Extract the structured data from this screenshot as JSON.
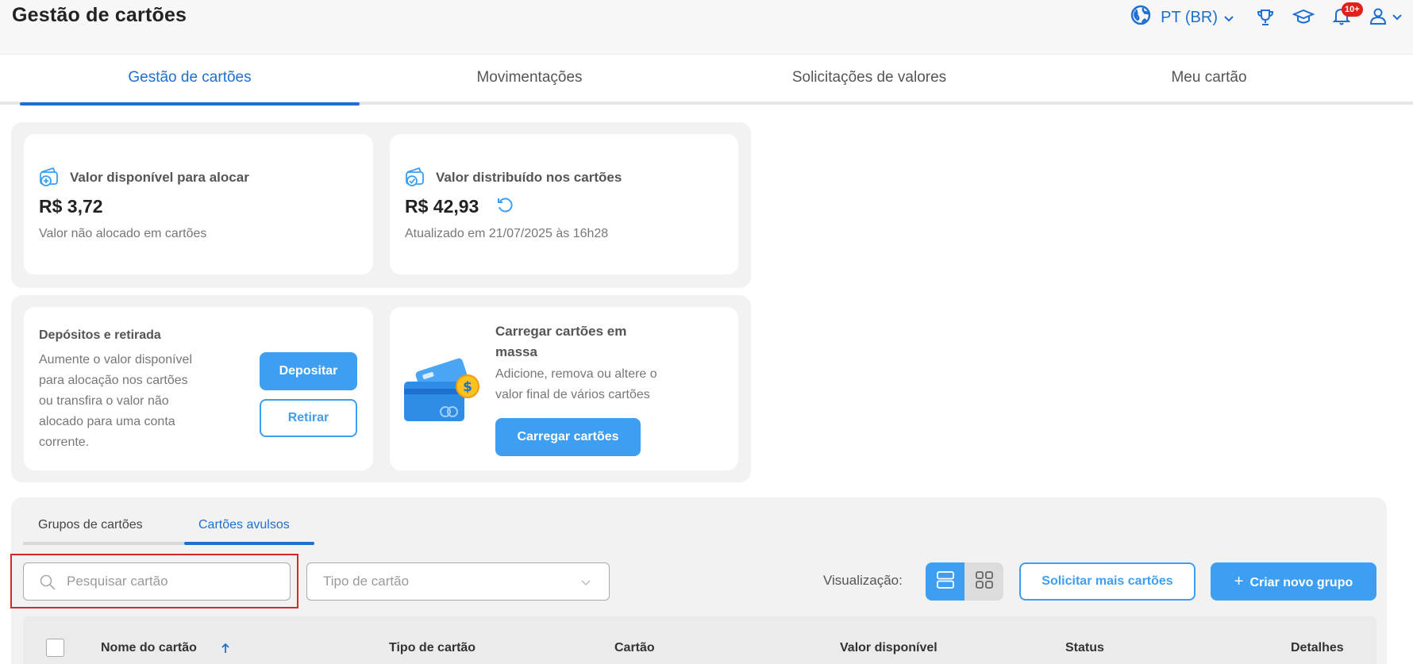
{
  "header": {
    "title": "Gestão de cartões",
    "language": "PT (BR)",
    "notification_badge": "10+"
  },
  "tabs": [
    {
      "label": "Gestão de cartões",
      "active": true
    },
    {
      "label": "Movimentações",
      "active": false
    },
    {
      "label": "Solicitações de valores",
      "active": false
    },
    {
      "label": "Meu cartão",
      "active": false
    }
  ],
  "summary": {
    "available": {
      "title": "Valor disponível para alocar",
      "amount": "R$ 3,72",
      "note": "Valor não alocado em cartões"
    },
    "distributed": {
      "title": "Valor distribuído nos cartões",
      "amount": "R$ 42,93",
      "note": "Atualizado em 21/07/2025 às 16h28"
    }
  },
  "deposits": {
    "title": "Depósitos e retirada",
    "description_lines": [
      "Aumente o valor disponível",
      "para alocação nos cartões",
      "ou transfira o valor não",
      "alocado para uma conta",
      "corrente."
    ],
    "deposit_label": "Depositar",
    "withdraw_label": "Retirar"
  },
  "bulk": {
    "title_lines": [
      "Carregar cartões em",
      "massa"
    ],
    "description_lines": [
      "Adicione, remova ou altere o",
      "valor final de vários cartões"
    ],
    "button_label": "Carregar cartões"
  },
  "subtabs": [
    {
      "label": "Grupos de cartões",
      "active": false
    },
    {
      "label": "Cartões avulsos",
      "active": true
    }
  ],
  "filters": {
    "search_placeholder": "Pesquisar cartão",
    "search_value": "",
    "type_placeholder": "Tipo de cartão",
    "view_label": "Visualização:",
    "request_more_label": "Solicitar mais cartões",
    "create_group_label": "Criar novo grupo"
  },
  "table": {
    "columns": [
      "Nome do cartão",
      "Tipo de cartão",
      "Cartão",
      "Valor disponível",
      "Status",
      "Detalhes"
    ]
  },
  "colors": {
    "accent": "#1f6fd1",
    "button": "#3d9ef2",
    "highlight": "#d9262b",
    "badge": "#e0201b"
  }
}
